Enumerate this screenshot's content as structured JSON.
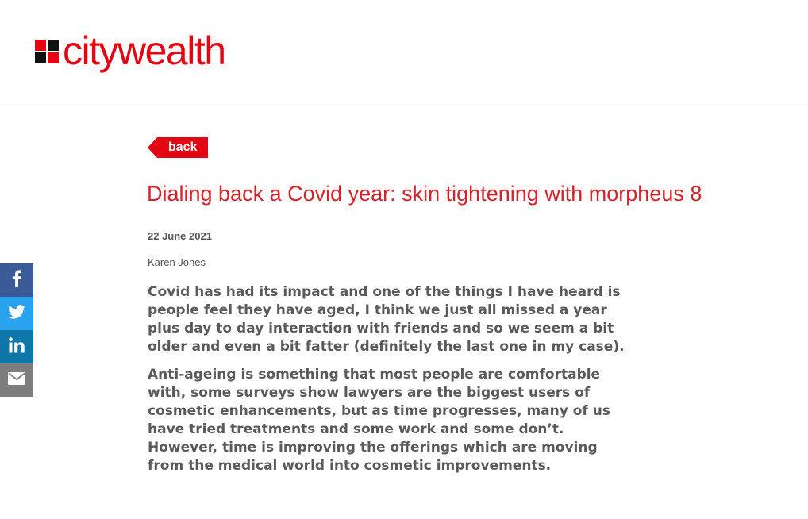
{
  "brand": {
    "name": "citywealth",
    "accent": "#e30613"
  },
  "nav": {
    "back_label": "back"
  },
  "article": {
    "title": "Dialing back a Covid year: skin tightening with morpheus 8",
    "date": "22 June 2021",
    "author": "Karen Jones",
    "paragraphs": [
      "Covid has had its impact and one of the things I have heard is people feel they have aged, I think we just all missed a year plus day to day interaction with friends and so we seem a bit older and even a bit fatter (definitely the last one in my case).",
      "Anti-ageing is something that most people are comfortable with, some surveys show lawyers are the biggest users of cosmetic enhancements, but as time progresses, many of us have tried treatments and some work and some don’t. However, time is improving the offerings which are moving from the medical world into cosmetic improvements."
    ]
  },
  "share": {
    "items": [
      {
        "icon": "facebook-icon",
        "color": "#3a5a98"
      },
      {
        "icon": "twitter-icon",
        "color": "#2aa3ef"
      },
      {
        "icon": "linkedin-icon",
        "color": "#0e76a8"
      },
      {
        "icon": "email-icon",
        "color": "#7d7d7d"
      }
    ]
  }
}
